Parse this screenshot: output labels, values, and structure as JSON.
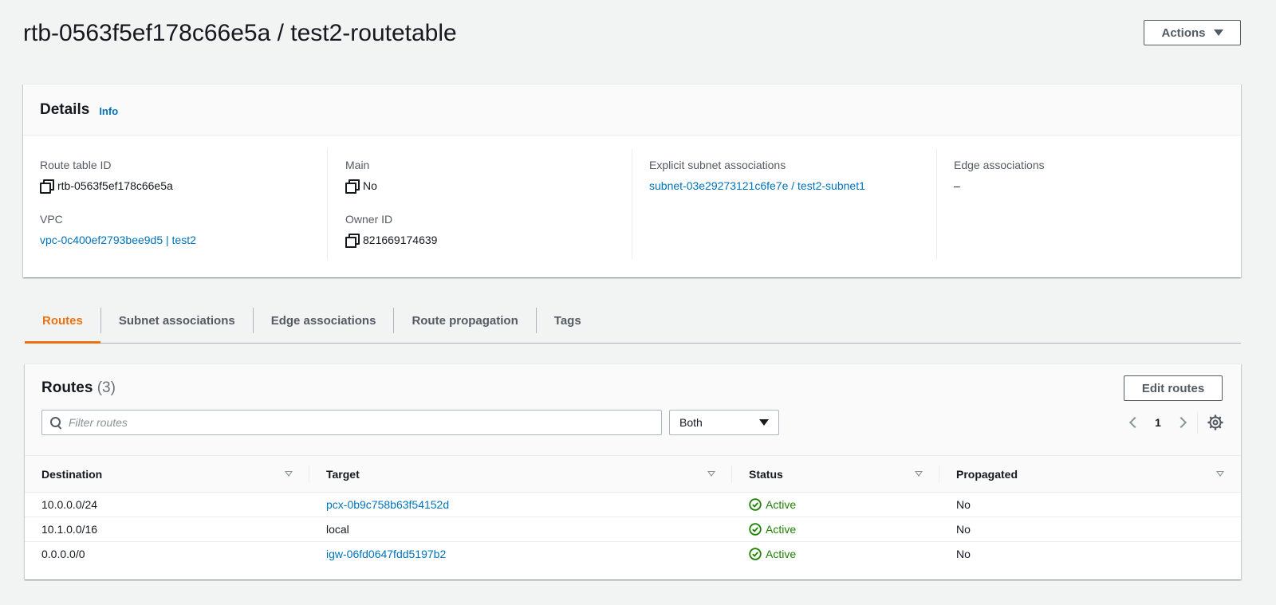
{
  "header": {
    "title": "rtb-0563f5ef178c66e5a / test2-routetable",
    "actions_label": "Actions"
  },
  "details": {
    "title": "Details",
    "info_label": "Info",
    "route_table_id": {
      "label": "Route table ID",
      "value": "rtb-0563f5ef178c66e5a"
    },
    "vpc": {
      "label": "VPC",
      "value": "vpc-0c400ef2793bee9d5 | test2"
    },
    "main": {
      "label": "Main",
      "value": "No"
    },
    "owner_id": {
      "label": "Owner ID",
      "value": "821669174639"
    },
    "explicit_subnet": {
      "label": "Explicit subnet associations",
      "value": "subnet-03e29273121c6fe7e / test2-subnet1"
    },
    "edge_associations": {
      "label": "Edge associations",
      "value": "–"
    }
  },
  "tabs": [
    {
      "label": "Routes",
      "active": true
    },
    {
      "label": "Subnet associations",
      "active": false
    },
    {
      "label": "Edge associations",
      "active": false
    },
    {
      "label": "Route propagation",
      "active": false
    },
    {
      "label": "Tags",
      "active": false
    }
  ],
  "routes": {
    "title": "Routes",
    "count": "(3)",
    "edit_label": "Edit routes",
    "filter_placeholder": "Filter routes",
    "select_value": "Both",
    "page": "1",
    "columns": [
      "Destination",
      "Target",
      "Status",
      "Propagated"
    ],
    "rows": [
      {
        "destination": "10.0.0.0/24",
        "target": "pcx-0b9c758b63f54152d",
        "target_link": true,
        "status": "Active",
        "propagated": "No"
      },
      {
        "destination": "10.1.0.0/16",
        "target": "local",
        "target_link": false,
        "status": "Active",
        "propagated": "No"
      },
      {
        "destination": "0.0.0.0/0",
        "target": "igw-06fd0647fdd5197b2",
        "target_link": true,
        "status": "Active",
        "propagated": "No"
      }
    ]
  },
  "colors": {
    "link": "#0073bb",
    "active_tab": "#ec7211",
    "status_active": "#1d8102",
    "background": "#f2f3f3"
  }
}
